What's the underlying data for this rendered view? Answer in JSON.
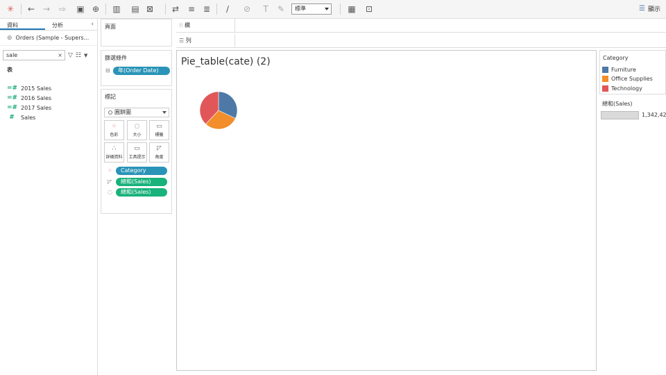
{
  "toolbar": {
    "style_select": "標準",
    "show_me_label": "顯示"
  },
  "data_pane": {
    "tabs": [
      "資料",
      "分析"
    ],
    "datasource": "Orders (Sample - Supers...",
    "search_value": "sale",
    "section_label": "表",
    "fields": [
      "2015 Sales",
      "2016 Sales",
      "2017 Sales",
      "Sales"
    ]
  },
  "pages_card": {
    "title": "頁面"
  },
  "filters_card": {
    "title": "篩選條件",
    "pill": "年(Order Date)"
  },
  "marks_card": {
    "title": "標記",
    "mark_type": "圓餅圖",
    "buttons": [
      "色彩",
      "大小",
      "標籤",
      "詳細資料",
      "工具提示",
      "角度"
    ],
    "pills": [
      "Category",
      "總和(Sales)",
      "總和(Sales)"
    ]
  },
  "shelves": {
    "columns": "欄",
    "rows": "列"
  },
  "view": {
    "title": "Pie_table(cate) (2)",
    "chart_data": {
      "type": "pie",
      "categories": [
        "Furniture",
        "Office Supplies",
        "Technology"
      ],
      "values": [
        32,
        30,
        38
      ],
      "colors": [
        "#4e79a7",
        "#f28e2b",
        "#e15759"
      ]
    }
  },
  "legend": {
    "title": "Category",
    "items": [
      "Furniture",
      "Office Supplies",
      "Technology"
    ],
    "colors": [
      "#4e79a7",
      "#f28e2b",
      "#e15759"
    ]
  },
  "size_legend": {
    "title": "總和(Sales)",
    "value": "1,342,42"
  }
}
